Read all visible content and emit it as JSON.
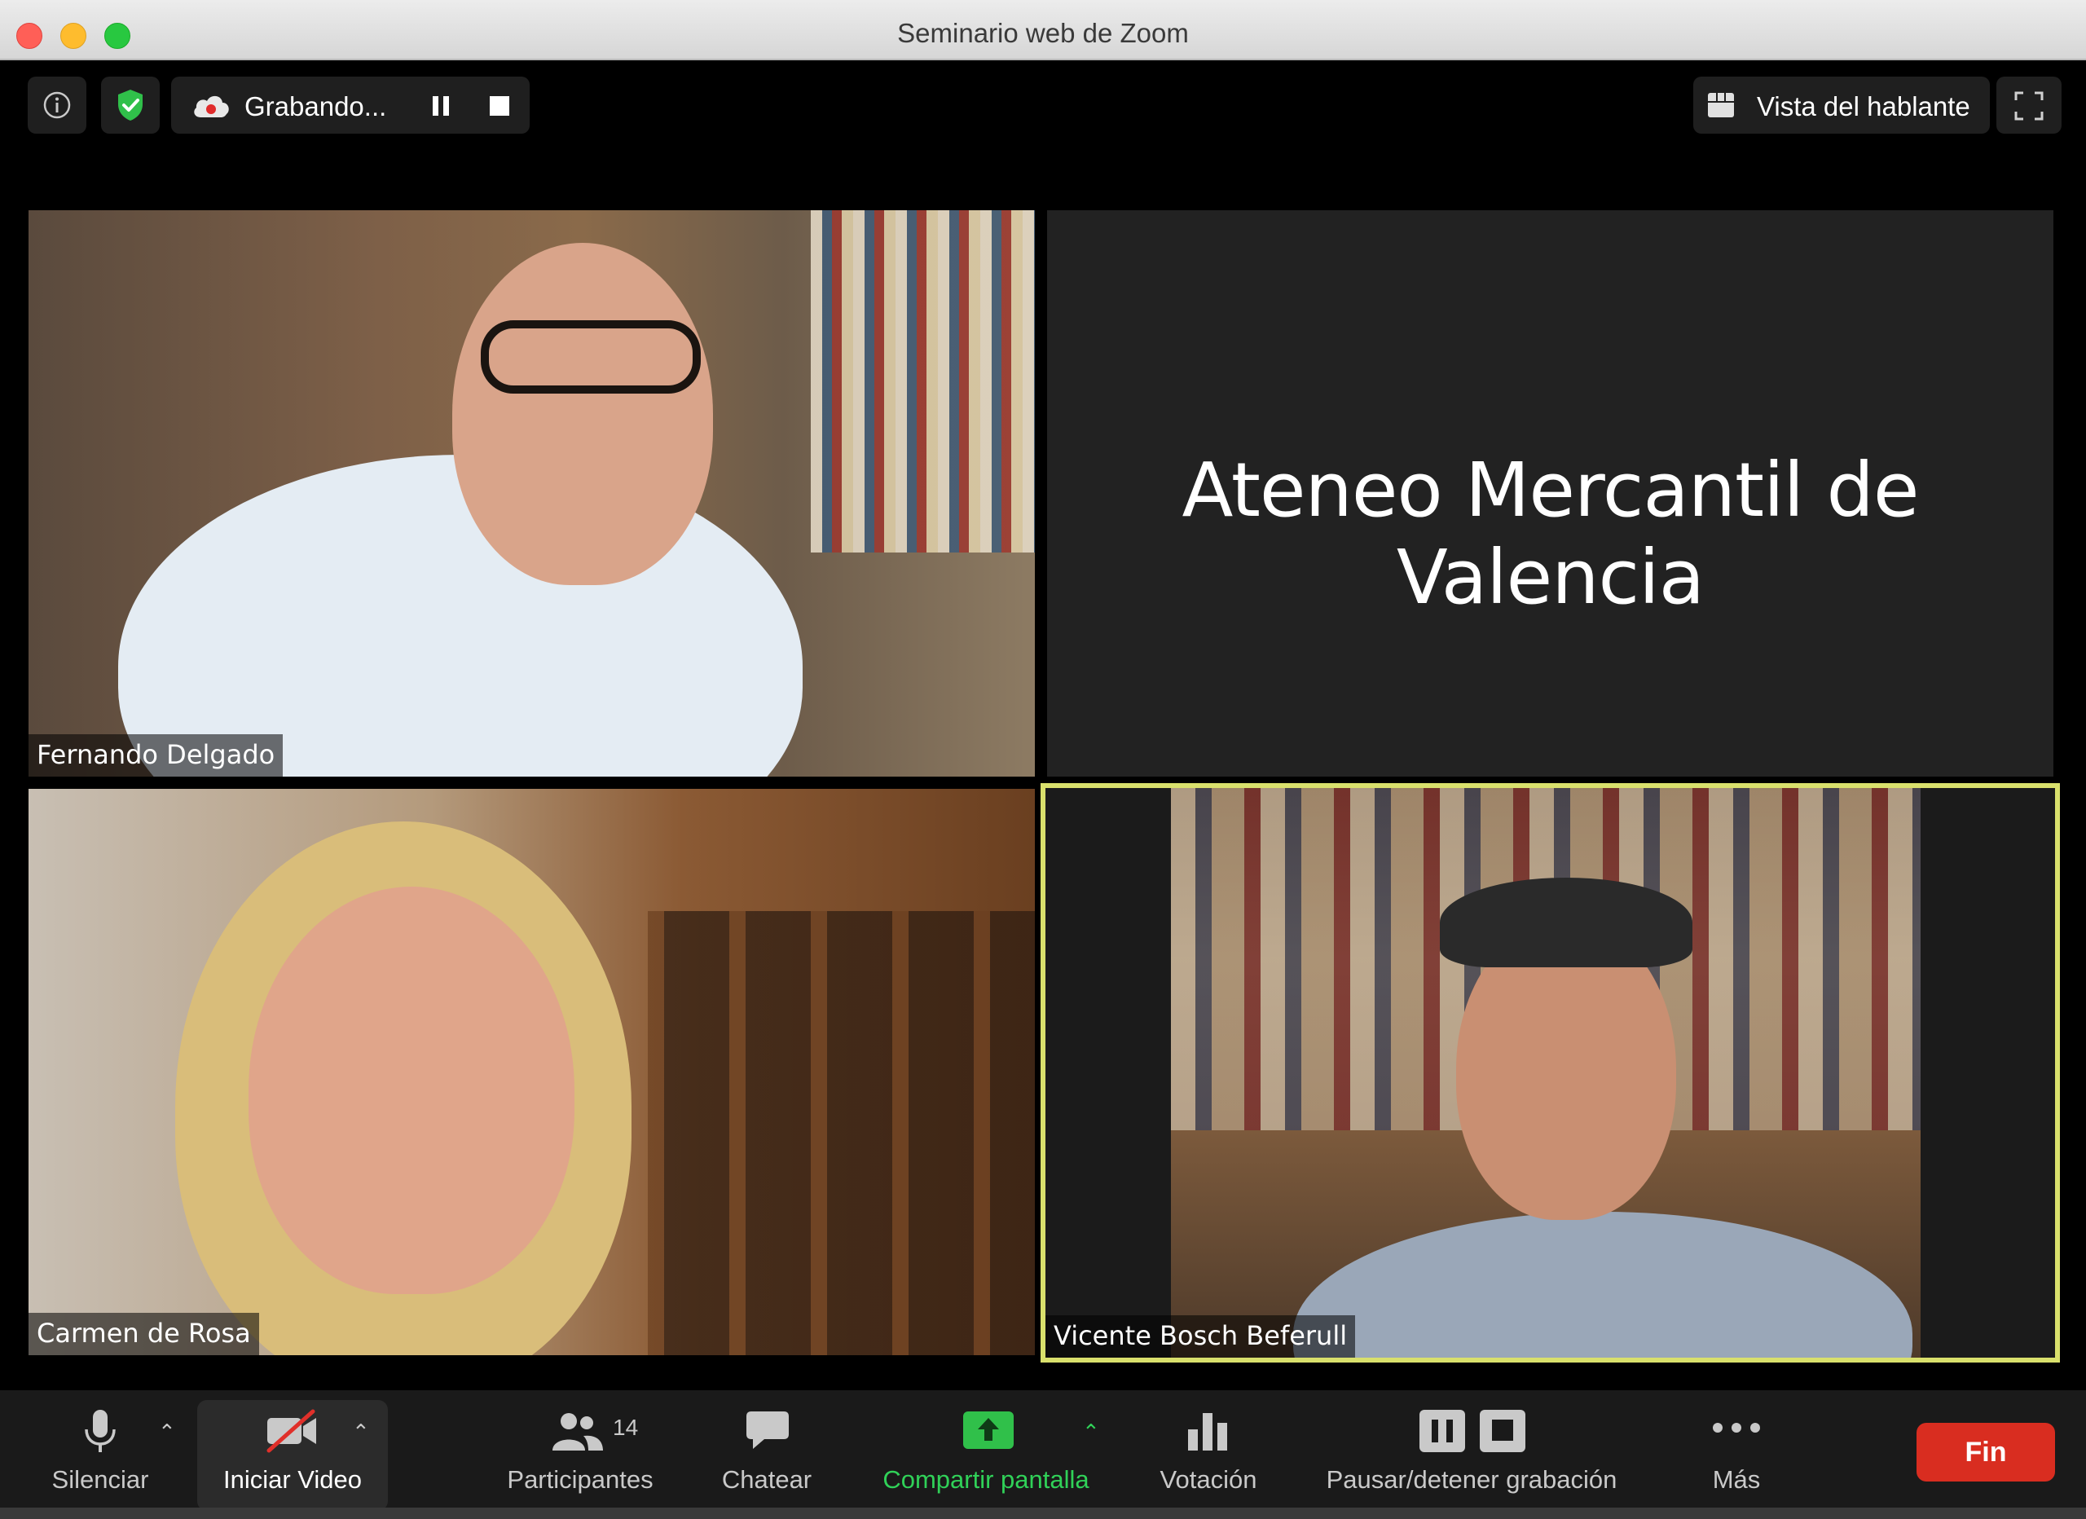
{
  "window": {
    "title": "Seminario web de Zoom"
  },
  "top_controls": {
    "recording_label": "Grabando...",
    "view_label": "Vista del hablante"
  },
  "tiles": [
    {
      "name": "Fernando Delgado"
    },
    {
      "name": "",
      "slide_text": "Ateneo Mercantil de Valencia"
    },
    {
      "name": "Carmen de Rosa"
    },
    {
      "name": "Vicente Bosch Beferull"
    }
  ],
  "toolbar": {
    "mute_label": "Silenciar",
    "video_label": "Iniciar Video",
    "participants_label": "Participantes",
    "participants_count": "14",
    "chat_label": "Chatear",
    "share_label": "Compartir pantalla",
    "poll_label": "Votación",
    "record_label": "Pausar/detener grabación",
    "more_label": "Más",
    "end_label": "Fin"
  },
  "colors": {
    "accent_green": "#30d158",
    "end_red": "#d92d20",
    "active_speaker_border": "#d9e06c"
  }
}
